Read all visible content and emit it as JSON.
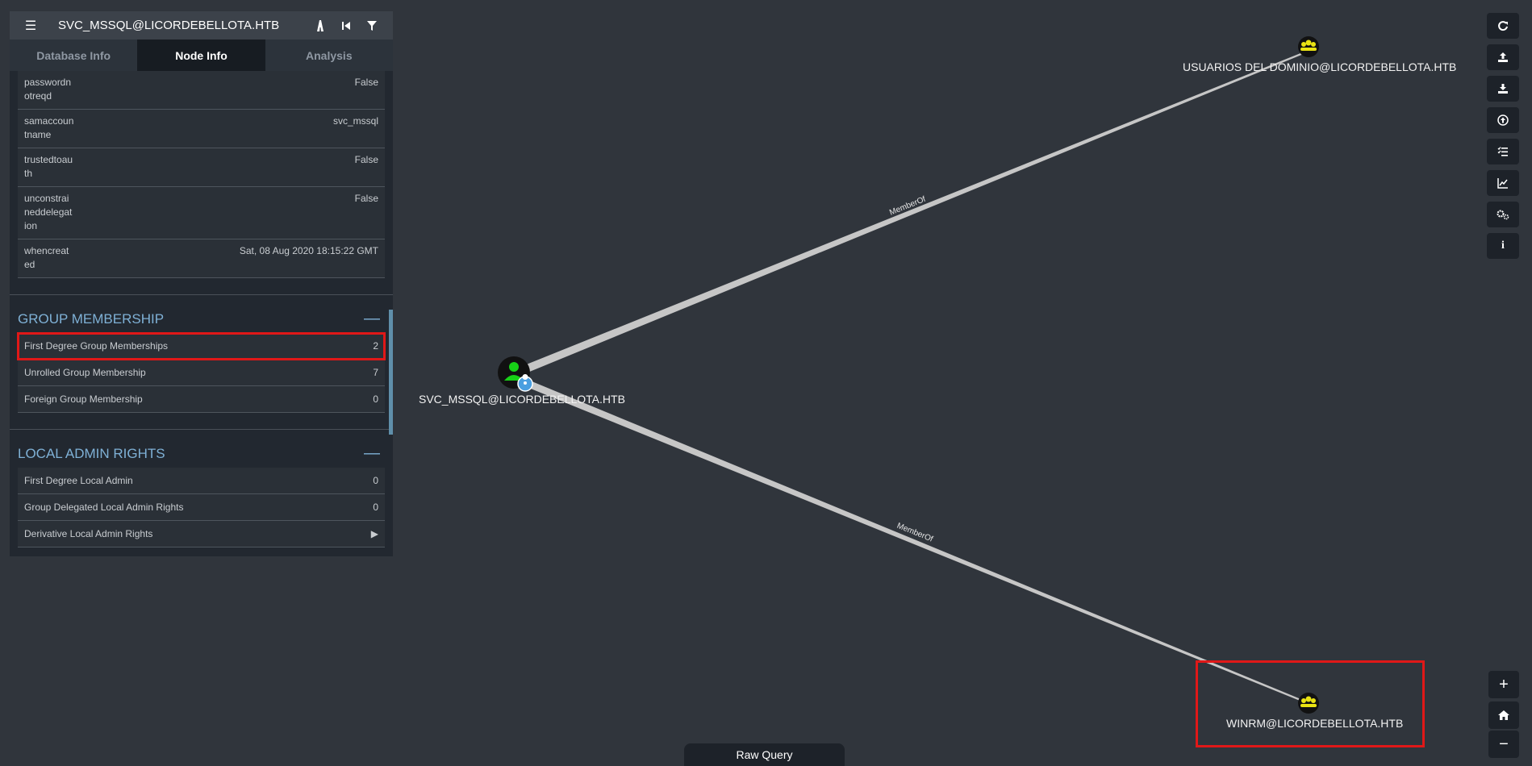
{
  "panel": {
    "title": "SVC_MSSQL@LICORDEBELLOTA.HTB",
    "tabs": [
      "Database Info",
      "Node Info",
      "Analysis"
    ],
    "active_tab": "Node Info",
    "properties": [
      {
        "key": "passwordnotreqd",
        "value": "False"
      },
      {
        "key": "samaccountname",
        "value": "svc_mssql"
      },
      {
        "key": "trustedtoauth",
        "value": "False"
      },
      {
        "key": "unconstraineddelegation",
        "value": "False"
      },
      {
        "key": "whencreated",
        "value": "Sat, 08 Aug 2020 18:15:22 GMT"
      }
    ],
    "group_membership": {
      "title": "GROUP MEMBERSHIP",
      "rows": [
        {
          "label": "First Degree Group Memberships",
          "value": "2"
        },
        {
          "label": "Unrolled Group Membership",
          "value": "7"
        },
        {
          "label": "Foreign Group Membership",
          "value": "0"
        }
      ]
    },
    "local_admin": {
      "title": "LOCAL ADMIN RIGHTS",
      "rows": [
        {
          "label": "First Degree Local Admin",
          "value": "0"
        },
        {
          "label": "Group Delegated Local Admin Rights",
          "value": "0"
        },
        {
          "label": "Derivative Local Admin Rights",
          "value": "▶"
        }
      ]
    }
  },
  "graph": {
    "nodes": {
      "user": "SVC_MSSQL@LICORDEBELLOTA.HTB",
      "group1": "USUARIOS DEL DOMINIO@LICORDEBELLOTA.HTB",
      "group2": "WINRM@LICORDEBELLOTA.HTB"
    },
    "edges": [
      "MemberOf",
      "MemberOf"
    ]
  },
  "toolbar": {
    "icons": [
      "refresh-icon",
      "upload-icon",
      "download-icon",
      "import-icon",
      "queries-icon",
      "stats-icon",
      "settings-icon",
      "info-icon"
    ]
  },
  "zoom": {
    "in": "+",
    "home": "⌂",
    "out": "−"
  },
  "raw_query_label": "Raw Query",
  "colors": {
    "accent": "#7fb1d6",
    "highlight": "#e01818",
    "user_node": "#17d117",
    "group_node": "#e9e313"
  }
}
